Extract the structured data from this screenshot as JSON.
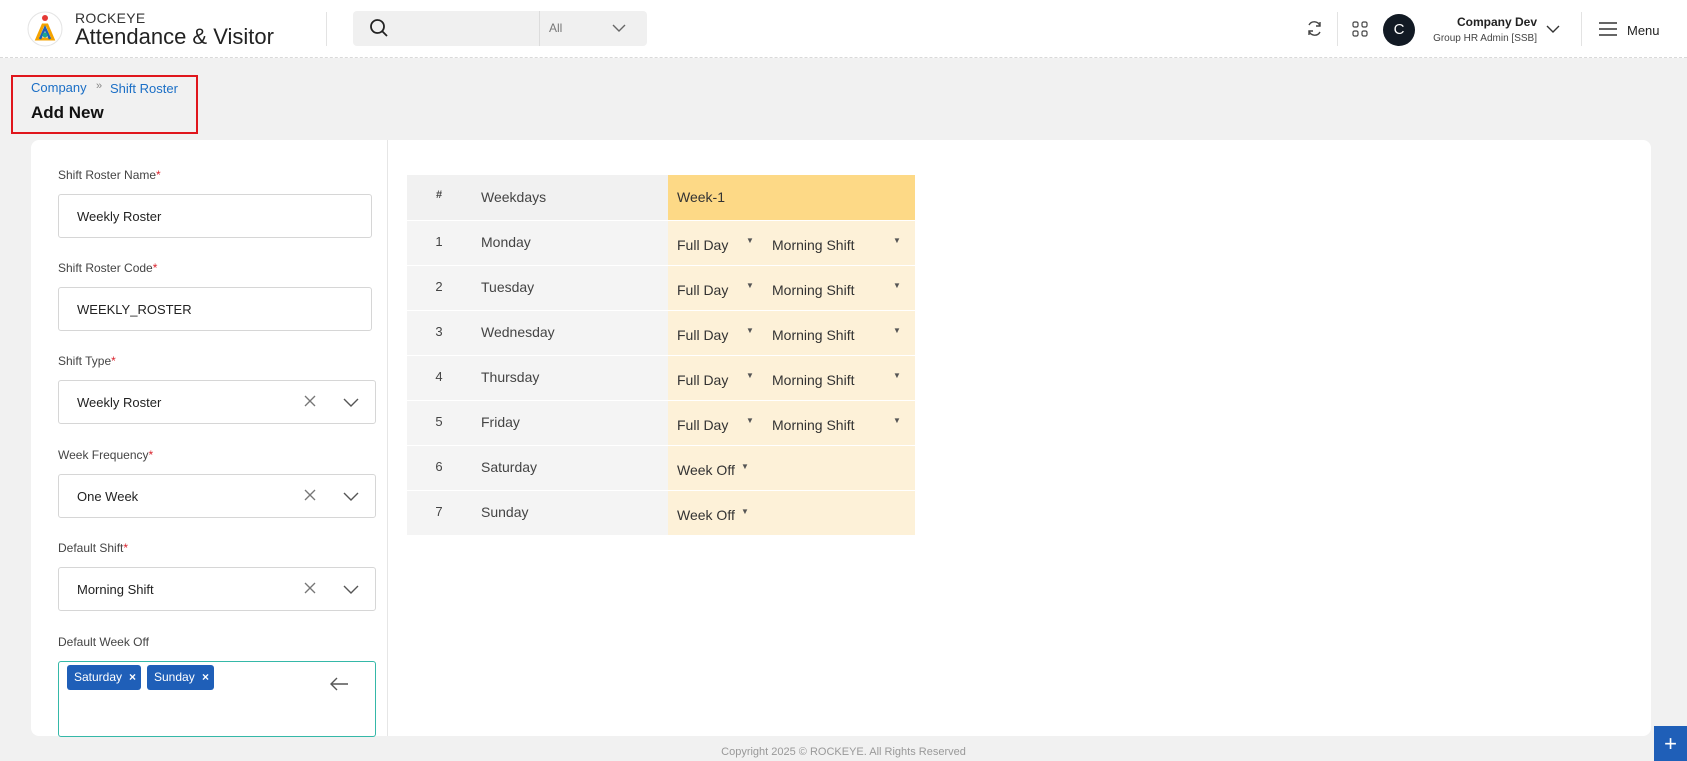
{
  "header": {
    "brand_small": "ROCKEYE",
    "brand_big": "Attendance & Visitor",
    "search_filter": "All",
    "avatar_letter": "C",
    "user_name": "Company Dev",
    "user_role": "Group HR Admin [SSB]",
    "menu_label": "Menu"
  },
  "breadcrumb": {
    "company": "Company",
    "separator": "»",
    "shift_roster": "Shift Roster",
    "page_title": "Add New"
  },
  "form": {
    "roster_name": {
      "label": "Shift Roster Name",
      "value": "Weekly Roster"
    },
    "roster_code": {
      "label": "Shift Roster Code",
      "value": "WEEKLY_ROSTER"
    },
    "shift_type": {
      "label": "Shift Type",
      "value": "Weekly Roster"
    },
    "week_frequency": {
      "label": "Week Frequency",
      "value": "One Week"
    },
    "default_shift": {
      "label": "Default Shift",
      "value": "Morning Shift"
    },
    "default_week_off": {
      "label": "Default Week Off",
      "tags": [
        "Saturday",
        "Sunday"
      ]
    },
    "required_mark": "*"
  },
  "roster": {
    "headers": {
      "num": "#",
      "day": "Weekdays",
      "week": "Week-1"
    },
    "rows": [
      {
        "num": "1",
        "day": "Monday",
        "type": "Full Day",
        "shift": "Morning Shift"
      },
      {
        "num": "2",
        "day": "Tuesday",
        "type": "Full Day",
        "shift": "Morning Shift"
      },
      {
        "num": "3",
        "day": "Wednesday",
        "type": "Full Day",
        "shift": "Morning Shift"
      },
      {
        "num": "4",
        "day": "Thursday",
        "type": "Full Day",
        "shift": "Morning Shift"
      },
      {
        "num": "5",
        "day": "Friday",
        "type": "Full Day",
        "shift": "Morning Shift"
      },
      {
        "num": "6",
        "day": "Saturday",
        "type": "Week Off",
        "shift": ""
      },
      {
        "num": "7",
        "day": "Sunday",
        "type": "Week Off",
        "shift": ""
      }
    ],
    "caret": "▼"
  },
  "footer": {
    "copyright": "Copyright 2025 © ROCKEYE. All Rights Reserved",
    "fab": "+"
  },
  "colors": {
    "accent_blue": "#1f5fb8",
    "week_header": "#fdd986",
    "week_cell": "#fdf1d8",
    "highlight_box": "#e0161c"
  }
}
